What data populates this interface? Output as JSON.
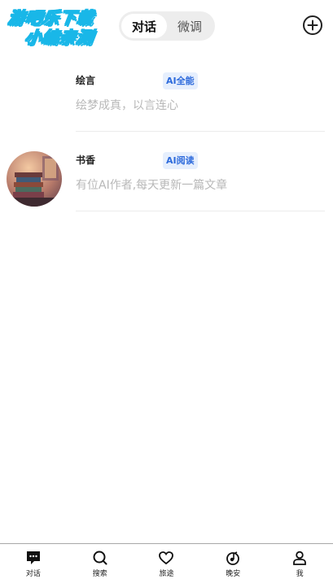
{
  "watermark": {
    "line1": "游吧乐下载",
    "line2": "小编亲测"
  },
  "tabs": [
    {
      "label": "对话",
      "active": true
    },
    {
      "label": "微调",
      "active": false
    }
  ],
  "header": {
    "add_icon": "plus-circle-icon"
  },
  "list": [
    {
      "name": "绘言",
      "badge": "AI全能",
      "desc": "绘梦成真，以言连心",
      "has_avatar": false
    },
    {
      "name": "书香",
      "badge": "AI阅读",
      "desc": "有位AI作者,每天更新一篇文章",
      "has_avatar": true
    }
  ],
  "nav": [
    {
      "label": "对话",
      "icon": "chat-bubble-icon",
      "active": true
    },
    {
      "label": "搜索",
      "icon": "search-icon",
      "active": false
    },
    {
      "label": "旅途",
      "icon": "heart-icon",
      "active": false
    },
    {
      "label": "晚安",
      "icon": "moon-music-icon",
      "active": false
    },
    {
      "label": "我",
      "icon": "user-icon",
      "active": false
    }
  ],
  "colors": {
    "badge_bg": "#e6effd",
    "badge_text": "#2e6bdc",
    "watermark": "#19b7e8"
  }
}
